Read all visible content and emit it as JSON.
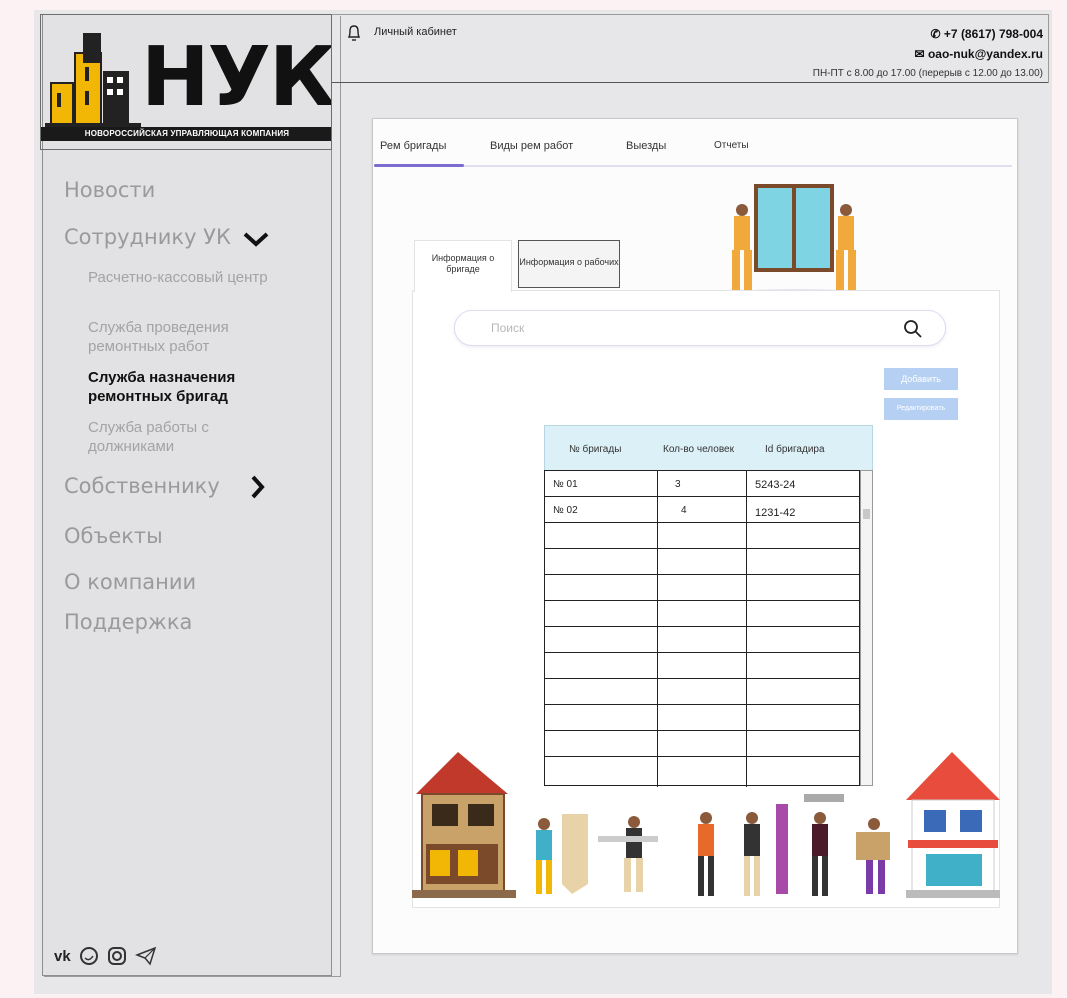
{
  "logo": {
    "text": "НУК",
    "strip": "НОВОРОССИЙСКАЯ УПРАВЛЯЮЩАЯ КОМПАНИЯ"
  },
  "nav": {
    "news": "Новости",
    "employee": "Сотруднику УК",
    "employee_sub": [
      "Расчетно-кассовый центр",
      "Служба проведения ремонтных работ",
      "Служба назначения ремонтных бригад",
      "Служба работы с должниками"
    ],
    "owner": "Собственнику",
    "objects": "Объекты",
    "about": "О компании",
    "support": "Поддержка"
  },
  "socials": [
    "vk-icon",
    "whatsapp-icon",
    "instagram-icon",
    "telegram-icon"
  ],
  "header": {
    "cabinet": "Личный кабинет",
    "phone": "+7 (8617) 798-004",
    "email": "oao-nuk@yandex.ru",
    "hours": "ПН-ПТ с 8.00 до 17.00 (перерыв с 12.00 до 13.00)"
  },
  "tabs": [
    "Рем бригады",
    "Виды рем работ",
    "Выезды",
    "Отчеты"
  ],
  "subtabs": [
    "Информация о бригаде",
    "Информация о рабочих"
  ],
  "search": {
    "placeholder": "Поиск"
  },
  "buttons": {
    "add": "Добавить",
    "edit": "Редактировать"
  },
  "table": {
    "headers": [
      "№ бригады",
      "Кол-во человек",
      "Id бригадира"
    ],
    "rows": [
      [
        "№ 01",
        "3",
        "5243-24"
      ],
      [
        "№ 02",
        "4",
        "1231-42"
      ]
    ]
  },
  "colors": {
    "accent": "#7b6ccf",
    "button": "#b6d0f4",
    "header_bg": "#dcf0f8",
    "logo_yellow": "#f2b705"
  }
}
